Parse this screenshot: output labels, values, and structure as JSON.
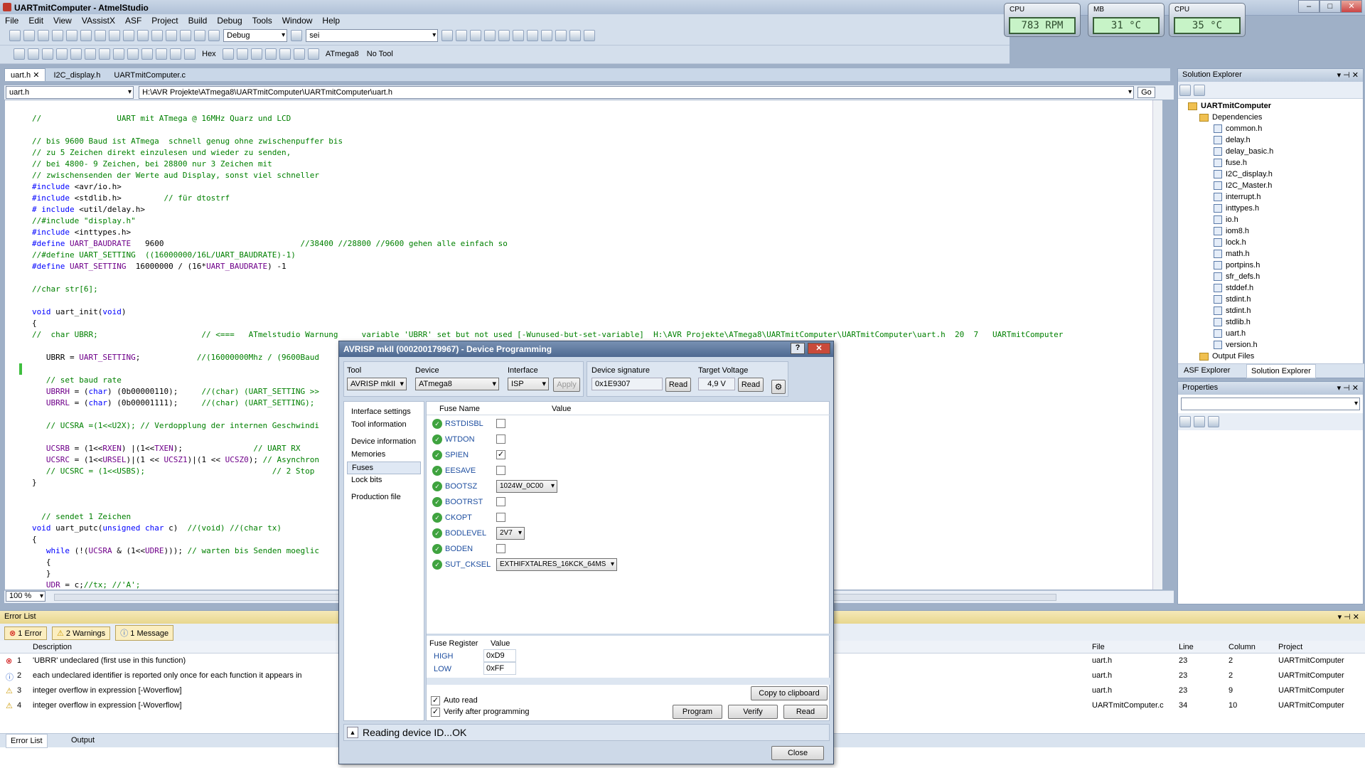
{
  "window": {
    "title": "UARTmitComputer - AtmelStudio"
  },
  "menu": [
    "File",
    "Edit",
    "View",
    "VAssistX",
    "ASF",
    "Project",
    "Build",
    "Debug",
    "Tools",
    "Window",
    "Help"
  ],
  "toolbar": {
    "config": "Debug",
    "search": "sei",
    "hex": "Hex",
    "device": "ATmega8",
    "tool": "No Tool"
  },
  "gadgets": [
    {
      "label": "CPU",
      "value": "783 RPM"
    },
    {
      "label": "MB",
      "value": "31 °C"
    },
    {
      "label": "CPU",
      "value": "35 °C"
    }
  ],
  "tabs": [
    "uart.h",
    "I2C_display.h",
    "UARTmitComputer.c"
  ],
  "nav": {
    "file": "uart.h",
    "path": "H:\\AVR Projekte\\ATmega8\\UARTmitComputer\\UARTmitComputer\\uart.h",
    "go": "Go"
  },
  "editor": {
    "zoom": "100 %"
  },
  "solution": {
    "title": "Solution Explorer",
    "project": "UARTmitComputer",
    "deps": "Dependencies",
    "files": [
      "common.h",
      "delay.h",
      "delay_basic.h",
      "fuse.h",
      "I2C_display.h",
      "I2C_Master.h",
      "interrupt.h",
      "inttypes.h",
      "io.h",
      "iom8.h",
      "lock.h",
      "math.h",
      "portpins.h",
      "sfr_defs.h",
      "stddef.h",
      "stdint.h",
      "stdint.h",
      "stdlib.h",
      "uart.h",
      "version.h"
    ],
    "output": "Output Files",
    "tab1": "ASF Explorer",
    "tab2": "Solution Explorer"
  },
  "properties": {
    "title": "Properties"
  },
  "errors": {
    "title": "Error List",
    "errbtn": "1 Error",
    "warnbtn": "2 Warnings",
    "msgbtn": "1 Message",
    "headers": [
      "Description",
      "File",
      "Line",
      "Column",
      "Project"
    ],
    "rows": [
      {
        "n": "1",
        "desc": "'UBRR' undeclared (first use in this function)",
        "file": "uart.h",
        "line": "23",
        "col": "2",
        "proj": "UARTmitComputer"
      },
      {
        "n": "2",
        "desc": "each undeclared identifier is reported only once for each function it appears in",
        "file": "uart.h",
        "line": "23",
        "col": "2",
        "proj": "UARTmitComputer"
      },
      {
        "n": "3",
        "desc": "integer overflow in expression [-Woverflow]",
        "file": "uart.h",
        "line": "23",
        "col": "9",
        "proj": "UARTmitComputer"
      },
      {
        "n": "4",
        "desc": "integer overflow in expression [-Woverflow]",
        "file": "UARTmitComputer.c",
        "line": "34",
        "col": "10",
        "proj": "UARTmitComputer"
      }
    ],
    "tab1": "Error List",
    "tab2": "Output"
  },
  "dialog": {
    "title": "AVRISP mkII (000200179967) - Device Programming",
    "tool_label": "Tool",
    "tool": "AVRISP mkII",
    "device_label": "Device",
    "device": "ATmega8",
    "iface_label": "Interface",
    "iface": "ISP",
    "apply": "Apply",
    "sig_label": "Device signature",
    "sig": "0x1E9307",
    "read": "Read",
    "volt_label": "Target Voltage",
    "volt": "4,9 V",
    "nav": [
      "Interface settings",
      "Tool information",
      "Device information",
      "Memories",
      "Fuses",
      "Lock bits",
      "Production file"
    ],
    "fuse_hdr": "Fuse Name",
    "val_hdr": "Value",
    "fuses": [
      {
        "name": "RSTDISBL",
        "type": "cb",
        "checked": ""
      },
      {
        "name": "WTDON",
        "type": "cb",
        "checked": ""
      },
      {
        "name": "SPIEN",
        "type": "cb",
        "checked": "✓"
      },
      {
        "name": "EESAVE",
        "type": "cb",
        "checked": ""
      },
      {
        "name": "BOOTSZ",
        "type": "sel",
        "value": "1024W_0C00"
      },
      {
        "name": "BOOTRST",
        "type": "cb",
        "checked": ""
      },
      {
        "name": "CKOPT",
        "type": "cb",
        "checked": ""
      },
      {
        "name": "BODLEVEL",
        "type": "sel",
        "value": "2V7"
      },
      {
        "name": "BODEN",
        "type": "cb",
        "checked": ""
      },
      {
        "name": "SUT_CKSEL",
        "type": "sel",
        "value": "EXTHIFXTALRES_16KCK_64MS"
      }
    ],
    "reg_hdr": "Fuse Register",
    "reg_val": "Value",
    "regs": [
      {
        "name": "HIGH",
        "value": "0xD9"
      },
      {
        "name": "LOW",
        "value": "0xFF"
      }
    ],
    "copy": "Copy to clipboard",
    "auto_read": "Auto read",
    "verify_after": "Verify after programming",
    "program": "Program",
    "verify": "Verify",
    "read2": "Read",
    "status": "Reading device ID...OK",
    "close": "Close"
  }
}
